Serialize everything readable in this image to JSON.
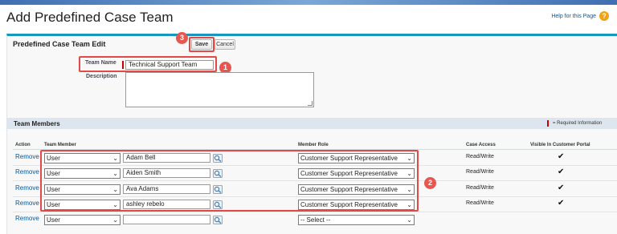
{
  "header": {
    "title": "Add Predefined Case Team",
    "help_link": "Help for this Page",
    "help_icon": "?"
  },
  "form": {
    "title": "Predefined Case Team Edit",
    "save_label": "Save",
    "cancel_label": "Cancel",
    "team_name_label": "Team Name",
    "team_name_value": "Technical Support Team",
    "description_label": "Description",
    "description_value": ""
  },
  "badges": [
    "1",
    "2",
    "3"
  ],
  "team_members": {
    "title": "Team Members",
    "required_info": "= Required Information",
    "columns": [
      "Action",
      "Team Member",
      "Member Role",
      "Case Access",
      "Visible In Customer Portal"
    ],
    "rows": [
      {
        "action": "Remove",
        "type": "User",
        "member": "Adam Bell",
        "role": "Customer Support Representative",
        "access": "Read/Write",
        "visible": "✔"
      },
      {
        "action": "Remove",
        "type": "User",
        "member": "Aiden Smith",
        "role": "Customer Support Representative",
        "access": "Read/Write",
        "visible": "✔"
      },
      {
        "action": "Remove",
        "type": "User",
        "member": "Ava Adams",
        "role": "Customer Support Representative",
        "access": "Read/Write",
        "visible": "✔"
      },
      {
        "action": "Remove",
        "type": "User",
        "member": "ashley rebelo",
        "role": "Customer Support Representative",
        "access": "Read/Write",
        "visible": "✔"
      },
      {
        "action": "Remove",
        "type": "User",
        "member": "",
        "role": "-- Select --",
        "access": "",
        "visible": ""
      }
    ]
  },
  "colors": {
    "accent": "#1797c0",
    "link": "#015ba7",
    "highlight": "#e34a47",
    "required": "#cc0000"
  },
  "icons": {
    "help": "help-icon",
    "lookup": "lookup-icon",
    "dropdown": "chevron-down-icon"
  }
}
